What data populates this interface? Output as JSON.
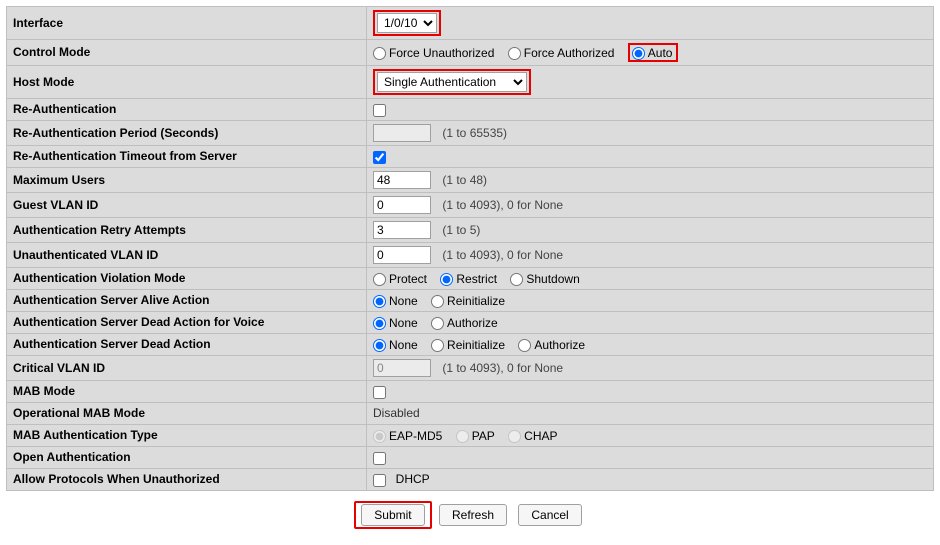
{
  "interface": {
    "label": "Interface",
    "value": "1/0/10"
  },
  "control_mode": {
    "label": "Control Mode",
    "options": {
      "unauth": "Force Unauthorized",
      "auth": "Force Authorized",
      "auto": "Auto"
    },
    "selected": "auto"
  },
  "host_mode": {
    "label": "Host Mode",
    "value": "Single Authentication"
  },
  "re_auth": {
    "label": "Re-Authentication",
    "checked": false
  },
  "re_auth_period": {
    "label": "Re-Authentication Period  (Seconds)",
    "value": "",
    "hint": "(1 to 65535)"
  },
  "re_auth_timeout": {
    "label": "Re-Authentication Timeout from Server",
    "checked": true
  },
  "max_users": {
    "label": "Maximum Users",
    "value": "48",
    "hint": "(1 to 48)"
  },
  "guest_vlan": {
    "label": "Guest VLAN ID",
    "value": "0",
    "hint": "(1 to 4093), 0 for None"
  },
  "auth_retry": {
    "label": "Authentication Retry Attempts",
    "value": "3",
    "hint": "(1 to 5)"
  },
  "unauth_vlan": {
    "label": "Unauthenticated VLAN ID",
    "value": "0",
    "hint": "(1 to 4093), 0 for None"
  },
  "violation_mode": {
    "label": "Authentication Violation Mode",
    "options": {
      "protect": "Protect",
      "restrict": "Restrict",
      "shutdown": "Shutdown"
    },
    "selected": "restrict"
  },
  "server_alive": {
    "label": "Authentication Server Alive Action",
    "options": {
      "none": "None",
      "reinit": "Reinitialize"
    },
    "selected": "none"
  },
  "server_dead_voice": {
    "label": "Authentication Server Dead Action for Voice",
    "options": {
      "none": "None",
      "authorize": "Authorize"
    },
    "selected": "none"
  },
  "server_dead": {
    "label": "Authentication Server Dead Action",
    "options": {
      "none": "None",
      "reinit": "Reinitialize",
      "authorize": "Authorize"
    },
    "selected": "none"
  },
  "critical_vlan": {
    "label": "Critical VLAN ID",
    "value": "0",
    "hint": "(1 to 4093), 0 for None"
  },
  "mab_mode": {
    "label": "MAB Mode",
    "checked": false
  },
  "op_mab_mode": {
    "label": "Operational MAB Mode",
    "value": "Disabled"
  },
  "mab_auth_type": {
    "label": "MAB Authentication Type",
    "options": {
      "eap": "EAP-MD5",
      "pap": "PAP",
      "chap": "CHAP"
    },
    "selected": "eap"
  },
  "open_auth": {
    "label": "Open Authentication",
    "checked": false
  },
  "allow_proto": {
    "label": "Allow Protocols When Unauthorized",
    "checked": false,
    "text": "DHCP"
  },
  "buttons": {
    "submit": "Submit",
    "refresh": "Refresh",
    "cancel": "Cancel"
  }
}
